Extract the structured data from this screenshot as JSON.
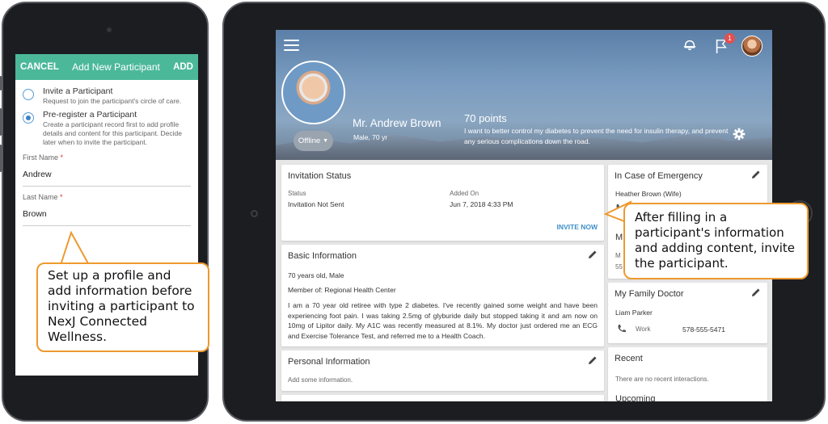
{
  "phone": {
    "header": {
      "cancel": "CANCEL",
      "title": "Add New Participant",
      "add": "ADD"
    },
    "options": [
      {
        "title": "Invite a Participant",
        "desc": "Request to join the participant's circle of care.",
        "checked": false
      },
      {
        "title": "Pre-register a Participant",
        "desc": "Create a participant record first to add profile details and content for this participant. Decide later when to invite the participant.",
        "checked": true
      }
    ],
    "first_name": {
      "label": "First Name",
      "req": "*",
      "value": "Andrew"
    },
    "last_name": {
      "label": "Last Name",
      "req": "*",
      "value": "Brown"
    }
  },
  "callout_left": "Set up a profile and add information before inviting a participant to NexJ Connected Wellness.",
  "callout_right": "After filling in a participant's information and adding content, invite the participant.",
  "profile": {
    "name": "Mr. Andrew Brown",
    "sub": "Male, 70 yr",
    "points": "70 points",
    "goal": "I want to better control my diabetes to prevent the need for insulin therapy, and prevent any serious complications down the road.",
    "status": "Offline",
    "notif_count": "1"
  },
  "invitation": {
    "title": "Invitation Status",
    "status_label": "Status",
    "status_value": "Invitation Not Sent",
    "added_label": "Added On",
    "added_value": "Jun 7, 2018 4:33 PM",
    "action": "INVITE NOW"
  },
  "basic": {
    "title": "Basic Information",
    "age": "70 years old, Male",
    "member": "Member of: Regional Health Center",
    "bio": "I am a 70 year old retiree with type 2 diabetes. I've recently gained some weight and have been experiencing foot pain. I was taking 2.5mg of glyburide daily but stopped taking it and am now on 10mg of Lipitor daily. My A1C was recently measured at 8.1%. My doctor just ordered me an ECG and Exercise Tolerance Test, and referred me to a Health Coach."
  },
  "personal": {
    "title": "Personal Information",
    "placeholder": "Add some information."
  },
  "emergency": {
    "title": "In Case of Emergency",
    "contact": "Heather Brown (Wife)",
    "partial_a": "M",
    "partial_b": "M",
    "partial_c": "55"
  },
  "doctor": {
    "title": "My Family Doctor",
    "name": "Liam Parker",
    "phone_label": "Work",
    "phone": "578-555-5471"
  },
  "recent": {
    "title": "Recent",
    "empty": "There are no recent interactions.",
    "upcoming": "Upcoming"
  },
  "colors": {
    "accent_green": "#4cb89a",
    "link_blue": "#3c8fc9",
    "callout_border": "#ed9a2e"
  }
}
